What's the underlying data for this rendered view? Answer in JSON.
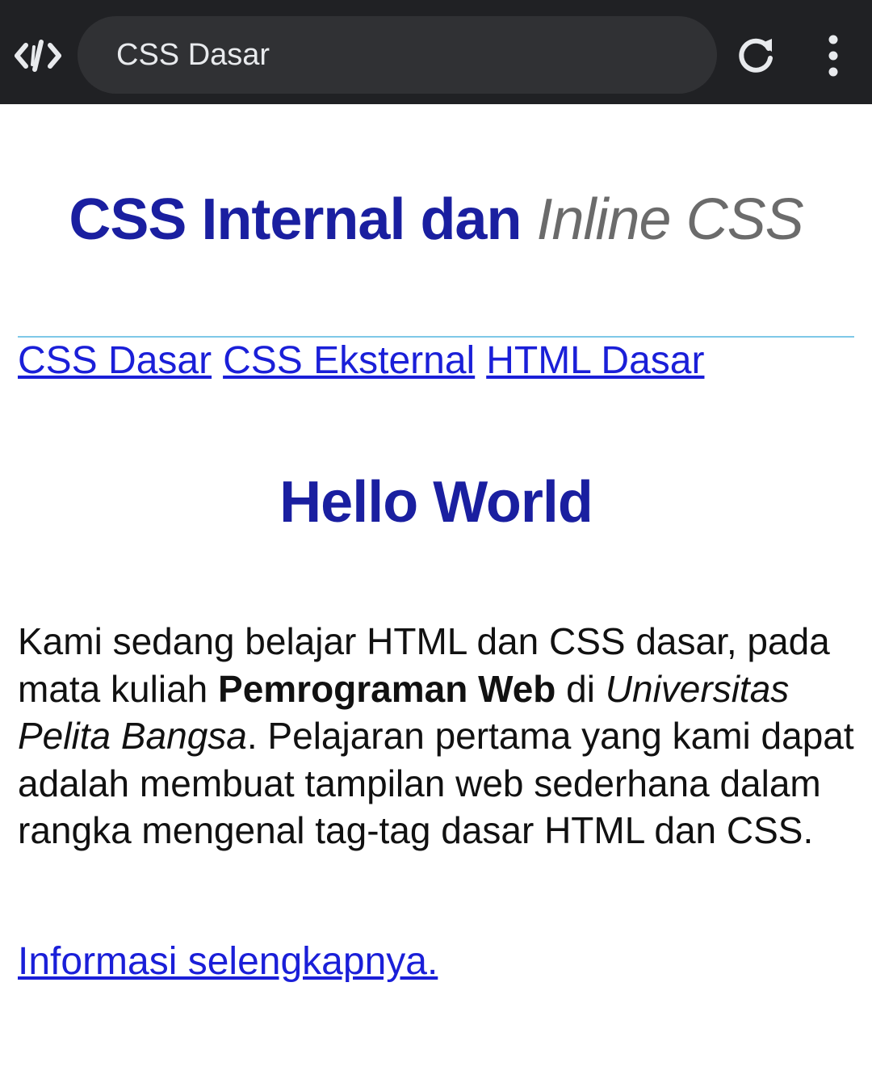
{
  "browser": {
    "url_text": "CSS Dasar",
    "app_icon": "code-brackets-icon",
    "reload_icon": "reload-icon",
    "menu_icon": "more-vertical-icon"
  },
  "page": {
    "title_main": "CSS Internal dan",
    "title_inline": "Inline CSS",
    "nav_links": [
      "CSS Dasar",
      "CSS Eksternal",
      "HTML Dasar"
    ],
    "heading": "Hello World",
    "paragraph": {
      "part1": "Kami sedang belajar HTML dan CSS dasar, pada mata kuliah ",
      "bold": "Pemrograman Web",
      "part2": " di ",
      "italic": "Universitas Pelita Bangsa",
      "part3": ". Pelajaran pertama yang kami dapat adalah membuat tampilan web sederhana dalam rangka mengenal tag-tag dasar HTML dan CSS."
    },
    "more_link": "Informasi selengkapnya."
  },
  "colors": {
    "heading": "#1a1fa0",
    "link": "#1a1fd8",
    "inline_gray": "#6b6b6b",
    "divider": "#7ec8e8",
    "toolbar": "#202124"
  }
}
